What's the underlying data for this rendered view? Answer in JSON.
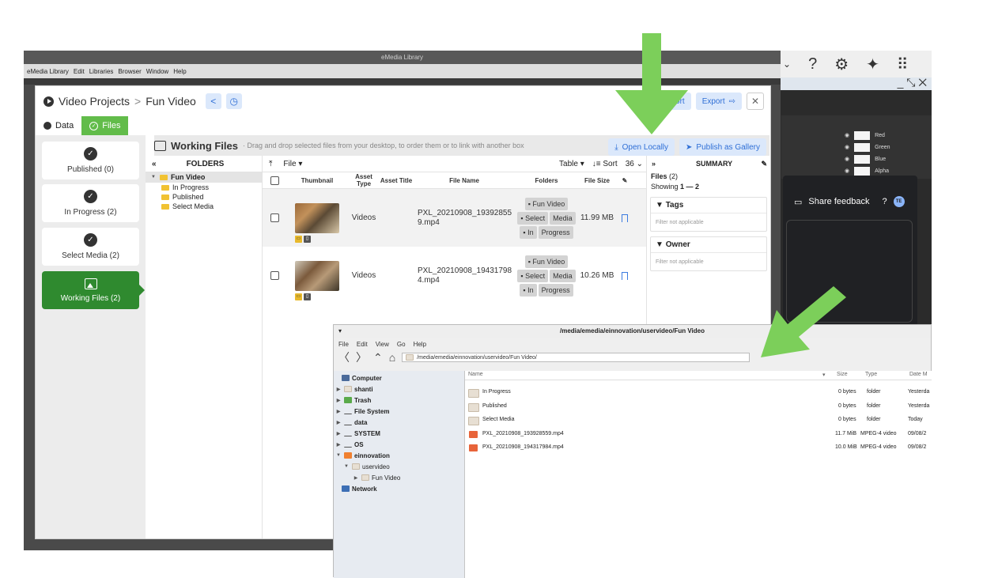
{
  "background_app": {
    "layers": [
      "Red",
      "Green",
      "Blue",
      "Alpha"
    ],
    "share_feedback": "Share feedback",
    "avatar_initials": "TE"
  },
  "emedia": {
    "window_title": "eMedia Library",
    "menu": [
      "eMedia Library",
      "Edit",
      "Libraries",
      "Browser",
      "Window",
      "Help"
    ],
    "breadcrumb": {
      "root": "Video Projects",
      "separator": ">",
      "current": "Fun Video"
    },
    "header_buttons": {
      "import": "Import",
      "export": "Export",
      "close": "✕"
    },
    "tabs": [
      {
        "label": "Data",
        "active": false
      },
      {
        "label": "Files",
        "active": true
      }
    ],
    "stages": [
      {
        "label": "Published (0)",
        "active": false
      },
      {
        "label": "In Progress (2)",
        "active": false
      },
      {
        "label": "Select Media (2)",
        "active": false
      },
      {
        "label": "Working Files (2)",
        "active": true
      }
    ],
    "working_files": {
      "title": "Working Files",
      "hint": "· Drag and drop selected files from your desktop, to order them or to link with another box",
      "open_locally": "Open Locally",
      "publish_gallery": "Publish as Gallery"
    },
    "folders": {
      "header": "FOLDERS",
      "collapse": "«",
      "root": "Fun Video",
      "children": [
        "In Progress",
        "Published",
        "Select Media"
      ]
    },
    "file_toolbar": {
      "file_menu": "File",
      "view": "Table",
      "sort": "Sort",
      "page_size": "36"
    },
    "table": {
      "headers": [
        "Thumbnail",
        "Asset Type",
        "Asset Title",
        "File Name",
        "Folders",
        "File Size"
      ],
      "rows": [
        {
          "asset_type": "Videos",
          "asset_title": "",
          "file_name": "PXL_20210908_193928559.mp4",
          "folders": [
            "Fun Video",
            "Select",
            "Media",
            "In",
            "Progress"
          ],
          "file_size": "11.99 MB"
        },
        {
          "asset_type": "Videos",
          "asset_title": "",
          "file_name": "PXL_20210908_194317984.mp4",
          "folders": [
            "Fun Video",
            "Select",
            "Media",
            "In",
            "Progress"
          ],
          "file_size": "10.26 MB"
        }
      ]
    },
    "summary": {
      "expand": "»",
      "header": "SUMMARY",
      "files_label": "Files",
      "files_count": "(2)",
      "showing_label": "Showing",
      "showing_range": "1 — 2",
      "facets": [
        {
          "title": "Tags",
          "body": "Filter not applicable"
        },
        {
          "title": "Owner",
          "body": "Filter not applicable"
        }
      ]
    }
  },
  "file_manager": {
    "title": "/media/emedia/einnovation/uservideo/Fun Video",
    "menu": [
      "File",
      "Edit",
      "View",
      "Go",
      "Help"
    ],
    "path": "/media/emedia/einnovation/uservideo/Fun Video/",
    "sidebar": [
      {
        "label": "Computer",
        "level": 0,
        "bold": true
      },
      {
        "label": "shanti",
        "level": 0,
        "bold": true
      },
      {
        "label": "Trash",
        "level": 0,
        "bold": true
      },
      {
        "label": "File System",
        "level": 0,
        "bold": true
      },
      {
        "label": "data",
        "level": 0,
        "bold": true
      },
      {
        "label": "SYSTEM",
        "level": 0,
        "bold": true
      },
      {
        "label": "OS",
        "level": 0,
        "bold": true
      },
      {
        "label": "einnovation",
        "level": 0,
        "bold": true
      },
      {
        "label": "uservideo",
        "level": 1,
        "bold": false
      },
      {
        "label": "Fun Video",
        "level": 2,
        "bold": false
      },
      {
        "label": "Network",
        "level": 0,
        "bold": true
      }
    ],
    "columns": [
      "Name",
      "Size",
      "Type",
      "Date M"
    ],
    "rows": [
      {
        "name": "In Progress",
        "size": "0 bytes",
        "type": "folder",
        "date": "Yesterda",
        "kind": "folder"
      },
      {
        "name": "Published",
        "size": "0 bytes",
        "type": "folder",
        "date": "Yesterda",
        "kind": "folder"
      },
      {
        "name": "Select Media",
        "size": "0 bytes",
        "type": "folder",
        "date": "Today",
        "kind": "folder"
      },
      {
        "name": "PXL_20210908_193928559.mp4",
        "size": "11.7 MiB",
        "type": "MPEG-4 video",
        "date": "09/08/2",
        "kind": "video"
      },
      {
        "name": "PXL_20210908_194317984.mp4",
        "size": "10.0 MiB",
        "type": "MPEG-4 video",
        "date": "09/08/2",
        "kind": "video"
      }
    ]
  },
  "colors": {
    "accent_green": "#62bc4a",
    "stage_green": "#2f8a2f",
    "arrow_green": "#7ccf5a",
    "link_blue": "#2f6fd6"
  }
}
